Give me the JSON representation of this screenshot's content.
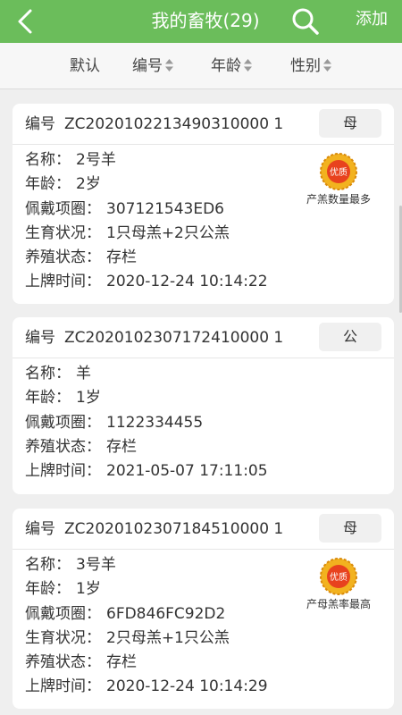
{
  "header": {
    "title": "我的畜牧(29)",
    "add_label": "添加"
  },
  "sort": {
    "items": [
      {
        "label": "默认"
      },
      {
        "label": "编号"
      },
      {
        "label": "年龄"
      },
      {
        "label": "性别"
      }
    ]
  },
  "cards": [
    {
      "code_label": "编号",
      "code": "ZC2020102213490310000 1",
      "gender": "母",
      "fields": [
        {
          "k": "名称：",
          "v": "2号羊"
        },
        {
          "k": "年龄：",
          "v": "2岁"
        },
        {
          "k": "佩戴项圈：",
          "v": "307121543ED6"
        },
        {
          "k": "生育状况：",
          "v": "1只母羔+2只公羔"
        },
        {
          "k": "养殖状态：",
          "v": "存栏"
        },
        {
          "k": "上牌时间：",
          "v": "2020-12-24 10:14:22"
        }
      ],
      "badge": {
        "medal": "优质",
        "text": "产羔数量最多"
      }
    },
    {
      "code_label": "编号",
      "code": "ZC2020102307172410000 1",
      "gender": "公",
      "fields": [
        {
          "k": "名称：",
          "v": "羊"
        },
        {
          "k": "年龄：",
          "v": "1岁"
        },
        {
          "k": "佩戴项圈：",
          "v": "1122334455"
        },
        {
          "k": "养殖状态：",
          "v": "存栏"
        },
        {
          "k": "上牌时间：",
          "v": "2021-05-07 17:11:05"
        }
      ]
    },
    {
      "code_label": "编号",
      "code": "ZC2020102307184510000 1",
      "gender": "母",
      "fields": [
        {
          "k": "名称：",
          "v": "3号羊"
        },
        {
          "k": "年龄：",
          "v": "1岁"
        },
        {
          "k": "佩戴项圈：",
          "v": "6FD846FC92D2"
        },
        {
          "k": "生育状况：",
          "v": "2只母羔+1只公羔"
        },
        {
          "k": "养殖状态：",
          "v": "存栏"
        },
        {
          "k": "上牌时间：",
          "v": "2020-12-24 10:14:29"
        }
      ],
      "badge": {
        "medal": "优质",
        "text": "产母羔率最高"
      }
    }
  ]
}
